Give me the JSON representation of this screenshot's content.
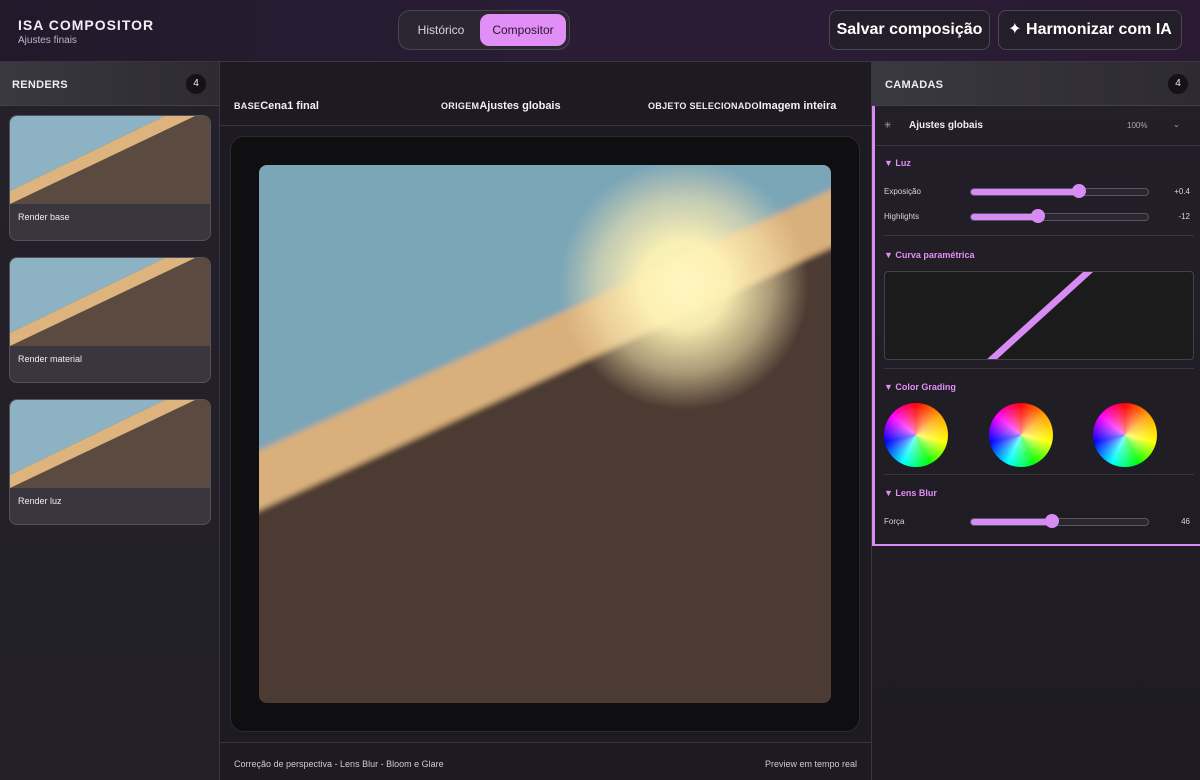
{
  "app": {
    "title": "ISA COMPOSITOR",
    "subtitle": "Ajustes finais"
  },
  "mode_tabs": [
    {
      "label": "Histórico",
      "active": false
    },
    {
      "label": "Compositor",
      "active": true
    }
  ],
  "actions": {
    "save": "Salvar composição",
    "harmonize": "✦ Harmonizar com IA"
  },
  "renders_panel": {
    "title": "RENDERS",
    "count": "4",
    "items": [
      {
        "label": "Render base"
      },
      {
        "label": "Render material"
      },
      {
        "label": "Render luz"
      }
    ]
  },
  "info": {
    "base_key": "BASE",
    "base_value": "Cena1 final",
    "origin_key": "ORIGEM",
    "origin_value": "Ajustes globais",
    "object_key": "OBJETO SELECIONADO",
    "object_value": "Imagem inteira"
  },
  "status": {
    "left": "Correção de perspectiva - Lens Blur - Bloom e Glare",
    "right": "Preview em tempo real"
  },
  "layers_panel": {
    "title": "CAMADAS",
    "count": "4",
    "layer": {
      "icon": "✳",
      "name": "Ajustes globais",
      "opacity": "100%",
      "chevron": "⌄"
    },
    "sections": {
      "light": "▼ Luz",
      "curve": "▼ Curva paramétrica",
      "grading": "▼ Color Grading",
      "blur": "▼ Lens Blur"
    },
    "controls": {
      "exposure": {
        "label": "Exposição",
        "value": "+0.4",
        "level": 0.61
      },
      "highlights": {
        "label": "Highlights",
        "value": "-12",
        "level": 0.38
      },
      "strength": {
        "label": "Força",
        "value": "46",
        "level": 0.46
      }
    }
  },
  "colors": {
    "accent": "#e28ef7",
    "sky": "#7aa6b8",
    "beam": "#ddb47e",
    "ground": "#4b3a31",
    "glow": "#fff6c0"
  }
}
